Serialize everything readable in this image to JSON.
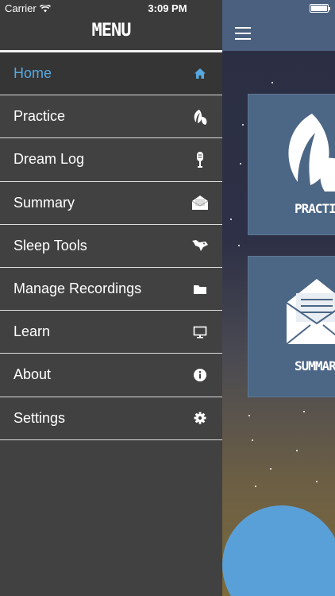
{
  "status_bar": {
    "carrier": "Carrier",
    "time": "3:09 PM"
  },
  "menu": {
    "title": "MENU",
    "items": [
      {
        "label": "Home",
        "icon": "home-icon",
        "active": true
      },
      {
        "label": "Practice",
        "icon": "leaf-icon"
      },
      {
        "label": "Dream Log",
        "icon": "microphone-icon"
      },
      {
        "label": "Summary",
        "icon": "envelope-icon"
      },
      {
        "label": "Sleep Tools",
        "icon": "fox-icon"
      },
      {
        "label": "Manage Recordings",
        "icon": "folder-icon"
      },
      {
        "label": "Learn",
        "icon": "monitor-icon"
      },
      {
        "label": "About",
        "icon": "info-icon"
      },
      {
        "label": "Settings",
        "icon": "gear-icon"
      }
    ]
  },
  "main": {
    "tiles": [
      {
        "label": "PRACTICE",
        "icon": "leaf-icon"
      },
      {
        "label": "SUMMARY",
        "icon": "envelope-icon"
      }
    ]
  },
  "colors": {
    "active": "#56a8e0",
    "drawer": "#414141",
    "navbar": "#4a607e",
    "tile": "#4c6685"
  }
}
